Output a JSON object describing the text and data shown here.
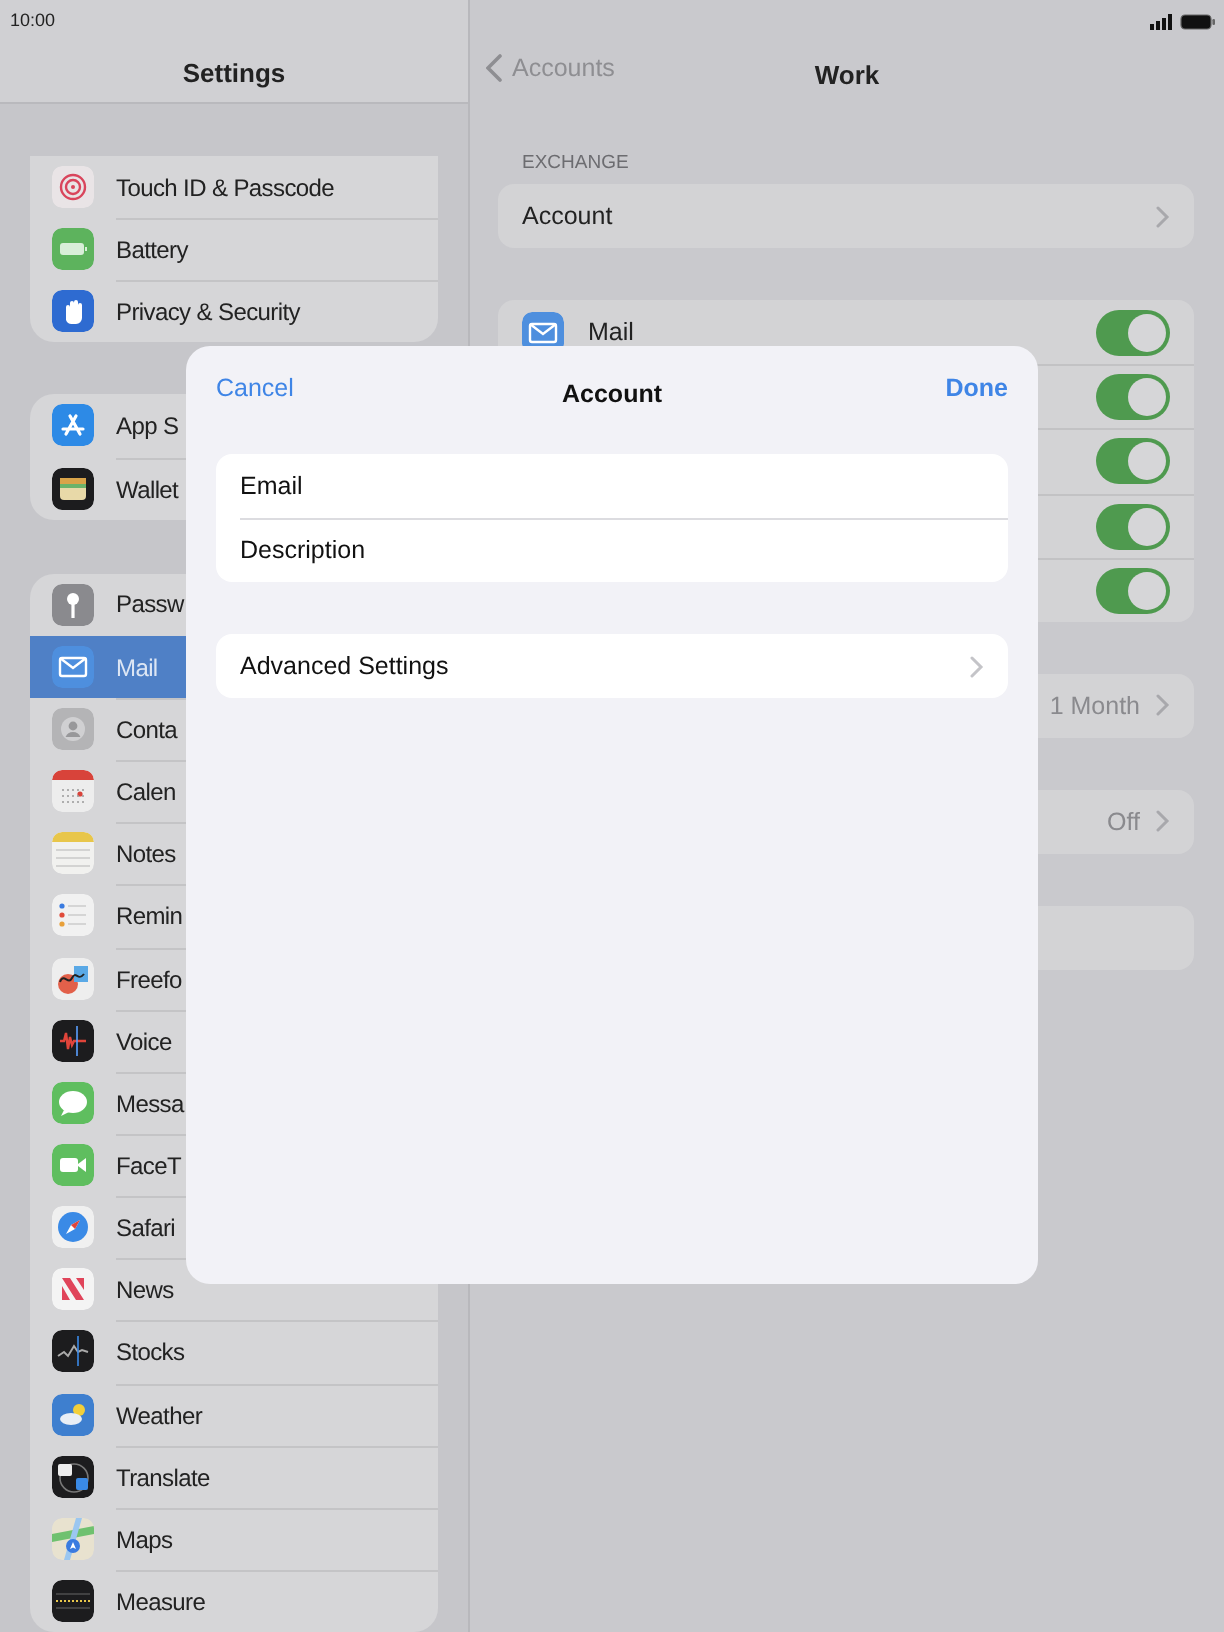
{
  "status_bar": {
    "time": "10:00"
  },
  "sidebar": {
    "title": "Settings",
    "groups": [
      {
        "items": [
          {
            "label": "Touch ID & Passcode",
            "selected": false
          },
          {
            "label": "Battery",
            "selected": false
          },
          {
            "label": "Privacy & Security",
            "selected": false
          }
        ]
      },
      {
        "items": [
          {
            "label": "App S",
            "selected": false
          },
          {
            "label": "Wallet",
            "selected": false
          }
        ]
      },
      {
        "items": [
          {
            "label": "Passw",
            "selected": false
          },
          {
            "label": "Mail",
            "selected": true
          },
          {
            "label": "Conta",
            "selected": false
          },
          {
            "label": "Calen",
            "selected": false
          },
          {
            "label": "Notes",
            "selected": false
          },
          {
            "label": "Remin",
            "selected": false
          },
          {
            "label": "Freefo",
            "selected": false
          },
          {
            "label": "Voice",
            "selected": false
          },
          {
            "label": "Messa",
            "selected": false
          },
          {
            "label": "FaceT",
            "selected": false
          },
          {
            "label": "Safari",
            "selected": false
          },
          {
            "label": "News",
            "selected": false
          },
          {
            "label": "Stocks",
            "selected": false
          },
          {
            "label": "Weather",
            "selected": false
          },
          {
            "label": "Translate",
            "selected": false
          },
          {
            "label": "Maps",
            "selected": false
          },
          {
            "label": "Measure",
            "selected": false
          }
        ]
      }
    ]
  },
  "detail": {
    "back": "Accounts",
    "title": "Work",
    "section_header": "EXCHANGE",
    "account_row": "Account",
    "toggles": [
      {
        "label": "Mail",
        "on": true
      },
      {
        "on": true
      },
      {
        "on": true
      },
      {
        "on": true
      },
      {
        "on": true
      }
    ],
    "value_rows": [
      {
        "value": "1 Month"
      },
      {
        "value": "Off"
      }
    ]
  },
  "sheet": {
    "cancel": "Cancel",
    "title": "Account",
    "done": "Done",
    "fields": [
      "Email",
      "Description"
    ],
    "advanced": "Advanced Settings"
  }
}
